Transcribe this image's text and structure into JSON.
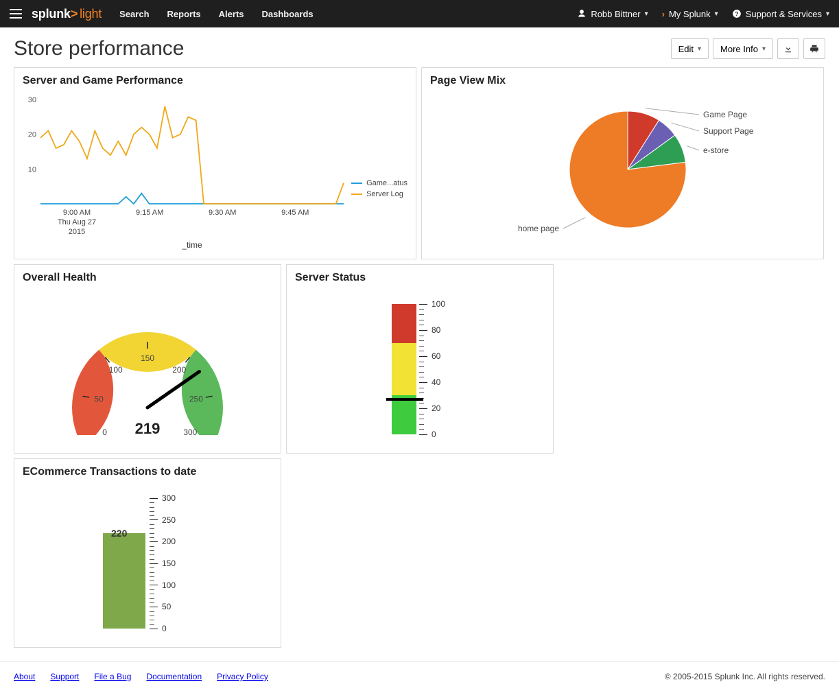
{
  "topbar": {
    "brand_main": "splunk",
    "brand_gt": ">",
    "brand_light": "light",
    "nav": [
      "Search",
      "Reports",
      "Alerts",
      "Dashboards"
    ],
    "user": "Robb Bittner",
    "my_splunk": "My Splunk",
    "support": "Support & Services"
  },
  "page": {
    "title": "Store performance",
    "edit_label": "Edit",
    "more_info_label": "More Info"
  },
  "panels": {
    "line": {
      "title": "Server and Game Performance",
      "xlabel": "_time",
      "legend": [
        "Game...atus",
        "Server Log"
      ],
      "x_time_date": "Thu Aug 27",
      "x_time_year": "2015"
    },
    "pie": {
      "title": "Page View Mix"
    },
    "gauge": {
      "title": "Overall Health"
    },
    "bar1": {
      "title": "Server Status"
    },
    "bar2": {
      "title": "ECommerce Transactions to date"
    }
  },
  "footer": {
    "links": [
      "About",
      "Support",
      "File a Bug",
      "Documentation",
      "Privacy Policy"
    ],
    "copyright": "© 2005-2015 Splunk Inc. All rights reserved."
  },
  "chart_data": [
    {
      "type": "line",
      "title": "Server and Game Performance",
      "xlabel": "_time",
      "y_ticks": [
        10,
        20,
        30
      ],
      "x_ticks": [
        "9:00 AM",
        "9:15 AM",
        "9:30 AM",
        "9:45 AM"
      ],
      "series": [
        {
          "name": "Game...atus",
          "color": "#1f9ed9",
          "values": [
            0,
            0,
            0,
            0,
            0,
            0,
            0,
            0,
            0,
            0,
            0,
            2,
            0,
            3,
            0,
            0,
            0,
            0,
            0,
            0,
            0,
            0,
            0,
            0,
            0,
            0,
            0,
            0,
            0,
            0,
            0,
            0,
            0,
            0,
            0,
            0,
            0,
            0,
            0,
            0
          ]
        },
        {
          "name": "Server Log",
          "color": "#f0a81a",
          "values": [
            19,
            21,
            16,
            17,
            21,
            18,
            13,
            21,
            16,
            14,
            18,
            14,
            20,
            22,
            20,
            16,
            28,
            19,
            20,
            25,
            24,
            0,
            0,
            0,
            0,
            0,
            0,
            0,
            0,
            0,
            0,
            0,
            0,
            0,
            0,
            0,
            0,
            0,
            0,
            6
          ]
        }
      ],
      "ylim": [
        0,
        30
      ]
    },
    {
      "type": "pie",
      "title": "Page View Mix",
      "slices": [
        {
          "label": "Game Page",
          "value": 9,
          "color": "#d03a2b"
        },
        {
          "label": "Support Page",
          "value": 6,
          "color": "#6b5fb4"
        },
        {
          "label": "e-store",
          "value": 8,
          "color": "#2e9e54"
        },
        {
          "label": "home page",
          "value": 77,
          "color": "#ee7b26"
        }
      ]
    },
    {
      "type": "gauge",
      "title": "Overall Health",
      "value": 219,
      "min": 0,
      "max": 300,
      "ticks": [
        0,
        50,
        100,
        150,
        200,
        250,
        300
      ],
      "bands": [
        {
          "from": 0,
          "to": 100,
          "color": "#e2573b"
        },
        {
          "from": 100,
          "to": 200,
          "color": "#f2d433"
        },
        {
          "from": 200,
          "to": 300,
          "color": "#5bb95b"
        }
      ]
    },
    {
      "type": "fill_gauge",
      "title": "Server Status",
      "value": 27,
      "min": 0,
      "max": 100,
      "ticks": [
        0,
        20,
        40,
        60,
        80,
        100
      ],
      "bands": [
        {
          "from": 0,
          "to": 30,
          "color": "#3ecb3e"
        },
        {
          "from": 30,
          "to": 70,
          "color": "#f2e233"
        },
        {
          "from": 70,
          "to": 100,
          "color": "#cf3a2c"
        }
      ]
    },
    {
      "type": "bar",
      "title": "ECommerce Transactions to date",
      "value": 220,
      "min": 0,
      "max": 300,
      "ticks": [
        0,
        50,
        100,
        150,
        200,
        250,
        300
      ],
      "color": "#7ea84a"
    }
  ]
}
